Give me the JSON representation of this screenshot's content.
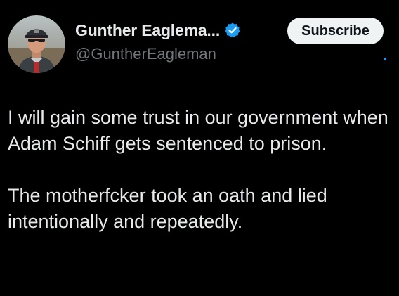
{
  "author": {
    "display_name": "Gunther Eaglema...",
    "handle": "@GuntherEagleman",
    "avatar_icon": "profile-photo-man-in-cap",
    "verified_icon": "verified-badge-icon",
    "verified_color": "#1d9bf0"
  },
  "actions": {
    "subscribe_label": "Subscribe"
  },
  "post": {
    "paragraphs": [
      "I will gain some trust in our government when Adam Schiff gets sentenced to prison.",
      "The motherfcker took an oath and lied intentionally and repeatedly."
    ]
  },
  "colors": {
    "background": "#000000",
    "text": "#e7e9ea",
    "secondary_text": "#71767b",
    "accent": "#1d9bf0"
  }
}
